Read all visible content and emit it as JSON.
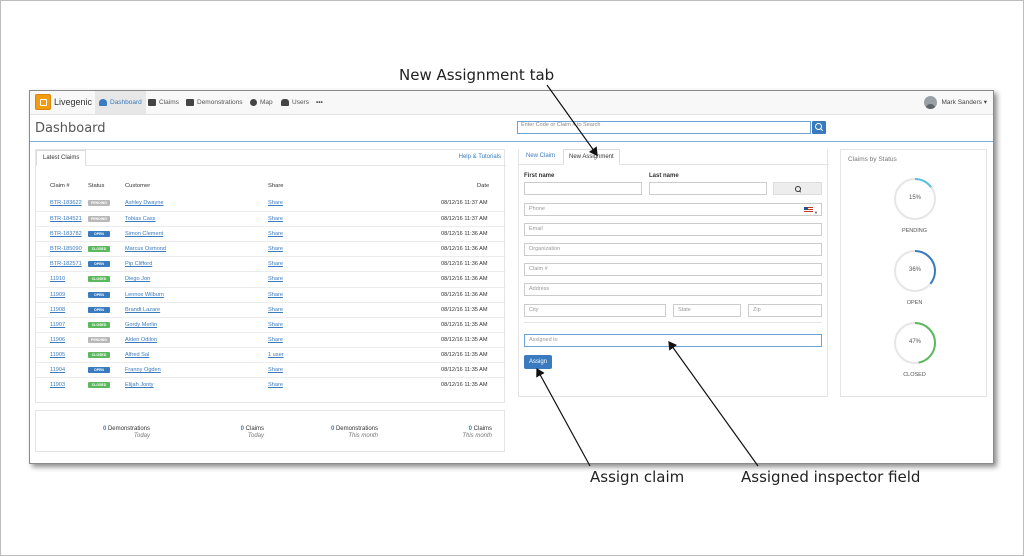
{
  "callouts": {
    "new_assignment_tab": "New Assignment tab",
    "assign_claim": "Assign claim",
    "assigned_inspector_field": "Assigned inspector field"
  },
  "navbar": {
    "brand": "Livegenic",
    "items": [
      {
        "label": "Dashboard",
        "icon": "dashboard-icon",
        "active": true
      },
      {
        "label": "Claims",
        "icon": "claims-icon"
      },
      {
        "label": "Demonstrations",
        "icon": "film-icon"
      },
      {
        "label": "Map",
        "icon": "globe-icon"
      },
      {
        "label": "Users",
        "icon": "users-icon"
      },
      {
        "label": "•••",
        "icon": "more-icon"
      }
    ],
    "user": "Mark Sanders ▾"
  },
  "page": {
    "title": "Dashboard",
    "search_placeholder": "Enter Code or Claim # to Search"
  },
  "claims": {
    "tab": "Latest Claims",
    "help": "Help & Tutorials",
    "headers": [
      "Claim #",
      "Status",
      "Customer",
      "Share",
      "Date"
    ],
    "rows": [
      {
        "claim": "BTR-183622",
        "status": "PENDING",
        "customer": "Ashley Dwayne",
        "share": "Share",
        "date": "08/12/16 11:37 AM"
      },
      {
        "claim": "BTR-184521",
        "status": "PENDING",
        "customer": "Tobias Cass",
        "share": "Share",
        "date": "08/12/16 11:37 AM"
      },
      {
        "claim": "BTR-183782",
        "status": "OPEN",
        "customer": "Simon Clement",
        "share": "Share",
        "date": "08/12/16 11:36 AM"
      },
      {
        "claim": "BTR-185090",
        "status": "CLOSED",
        "customer": "Marcus Osmond",
        "share": "Share",
        "date": "08/12/16 11:36 AM"
      },
      {
        "claim": "BTR-182571",
        "status": "OPEN",
        "customer": "Pip Clifford",
        "share": "Share",
        "date": "08/12/16 11:36 AM"
      },
      {
        "claim": "11910",
        "status": "CLOSED",
        "customer": "Diego Jon",
        "share": "Share",
        "date": "08/12/16 11:36 AM"
      },
      {
        "claim": "11909",
        "status": "OPEN",
        "customer": "Lennox Wilburn",
        "share": "Share",
        "date": "08/12/16 11:36 AM"
      },
      {
        "claim": "11908",
        "status": "OPEN",
        "customer": "Brandt Lazare",
        "share": "Share",
        "date": "08/12/16 11:35 AM"
      },
      {
        "claim": "11907",
        "status": "CLOSED",
        "customer": "Gordy Merlin",
        "share": "Share",
        "date": "08/12/16 11:35 AM"
      },
      {
        "claim": "11906",
        "status": "PENDING",
        "customer": "Alden Odilon",
        "share": "Share",
        "date": "08/12/16 11:35 AM"
      },
      {
        "claim": "11905",
        "status": "CLOSED",
        "customer": "Alfred Sal",
        "share": "1 user",
        "date": "08/12/16 11:35 AM"
      },
      {
        "claim": "11904",
        "status": "OPEN",
        "customer": "Franny Ogden",
        "share": "Share",
        "date": "08/12/16 11:35 AM"
      },
      {
        "claim": "11903",
        "status": "CLOSED",
        "customer": "Elijah Jonty",
        "share": "Share",
        "date": "08/12/16 11:35 AM"
      }
    ],
    "status_colors": {
      "PENDING": "#b8b8b8",
      "OPEN": "#3a7bbf",
      "CLOSED": "#5cb85c"
    }
  },
  "stats": [
    {
      "num": "0",
      "label": "Demonstrations",
      "period": "Today"
    },
    {
      "num": "0",
      "label": "Claims",
      "period": "Today"
    },
    {
      "num": "0",
      "label": "Demonstrations",
      "period": "This month"
    },
    {
      "num": "0",
      "label": "Claims",
      "period": "This month"
    }
  ],
  "assignment": {
    "tab_new_claim": "New Claim",
    "tab_new_assignment": "New Assignment",
    "first_name_label": "First name",
    "last_name_label": "Last name",
    "placeholders": {
      "phone": "Phone",
      "email": "Email",
      "organization": "Organization",
      "claim": "Claim #",
      "address": "Address",
      "city": "City",
      "state": "State",
      "zip": "Zip",
      "assigned_to": "Assigned to"
    },
    "assign_button": "Assign"
  },
  "status_panel": {
    "title": "Claims by Status",
    "items": [
      {
        "label": "PENDING",
        "pct_text": "15%",
        "fraction": 0.15,
        "color": "#5bc0de"
      },
      {
        "label": "OPEN",
        "pct_text": "36%",
        "fraction": 0.36,
        "color": "#3a7bbf"
      },
      {
        "label": "CLOSED",
        "pct_text": "47%",
        "fraction": 0.47,
        "color": "#5cb85c"
      }
    ]
  }
}
